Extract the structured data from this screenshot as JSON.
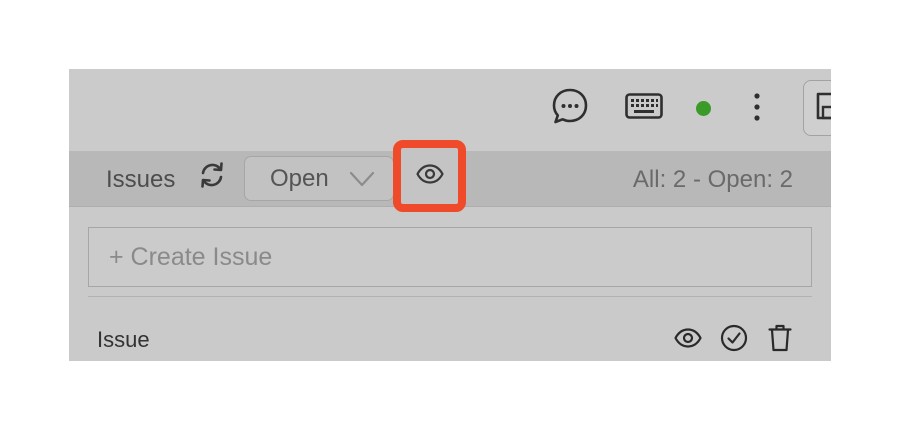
{
  "colors": {
    "status_online": "#3a9b29",
    "highlight": "#ef4a2a",
    "icon": "#2f2f2f"
  },
  "topbar": {
    "icons": [
      "chat-bubble-icon",
      "keyboard-icon",
      "status-dot",
      "more-vertical-icon",
      "save-icon"
    ]
  },
  "issues_bar": {
    "title": "Issues",
    "refresh_icon": "refresh-icon",
    "status_filter": {
      "value": "Open",
      "icon": "chevron-down-icon"
    },
    "watch_icon": "eye-icon",
    "counts": "All: 2 - Open: 2"
  },
  "create_issue": {
    "placeholder": "+ Create Issue"
  },
  "issues": [
    {
      "title": "Issue",
      "actions": [
        "eye-icon",
        "check-circle-icon",
        "trash-icon"
      ]
    }
  ]
}
